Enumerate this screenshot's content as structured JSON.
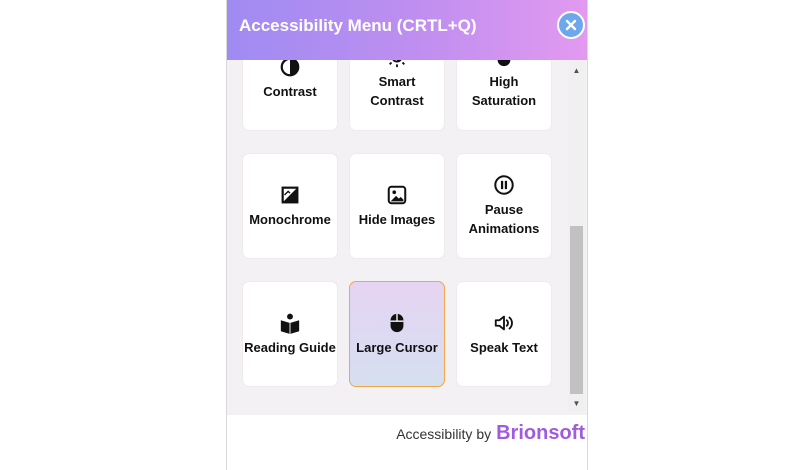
{
  "header": {
    "title": "Accessibility Menu (CRTL+Q)",
    "close_icon": "close-x-icon"
  },
  "tiles": [
    {
      "label": "Contrast",
      "icon": "contrast-icon",
      "selected": false
    },
    {
      "label": "Smart\nContrast",
      "icon": "smart-contrast-icon",
      "selected": false
    },
    {
      "label": "High\nSaturation",
      "icon": "saturation-icon",
      "selected": false
    },
    {
      "label": "Monochrome",
      "icon": "monochrome-icon",
      "selected": false
    },
    {
      "label": "Hide Images",
      "icon": "image-icon",
      "selected": false
    },
    {
      "label": "Pause\nAnimations",
      "icon": "pause-icon",
      "selected": false
    },
    {
      "label": "Reading Guide",
      "icon": "reading-guide-icon",
      "selected": false
    },
    {
      "label": "Large Cursor",
      "icon": "mouse-icon",
      "selected": true
    },
    {
      "label": "Speak Text",
      "icon": "speaker-icon",
      "selected": false
    }
  ],
  "footer": {
    "prefix": "Accessibility by",
    "brand": "Brionsoft"
  },
  "colors": {
    "header_gradient_start": "#9f8bf2",
    "header_gradient_end": "#e39af0",
    "close_button": "#6ea8ec",
    "brand": "#a05cdf",
    "selected_border": "#f0a74a"
  }
}
